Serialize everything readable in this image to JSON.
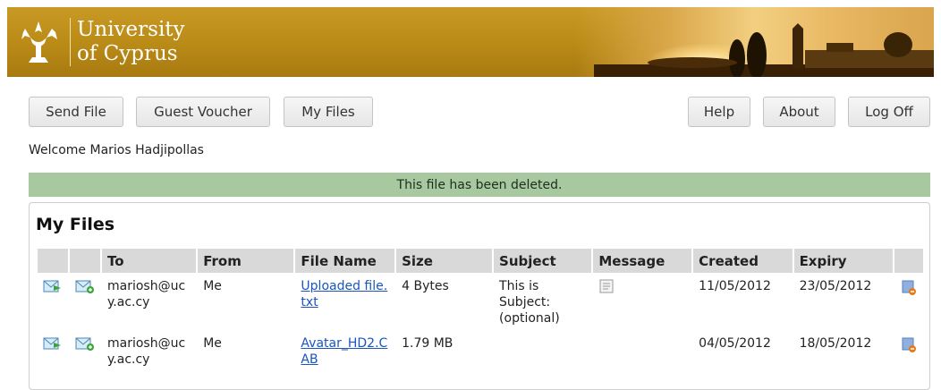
{
  "header": {
    "logo_line1": "University",
    "logo_line2": "of Cyprus"
  },
  "toolbar": {
    "send_file": "Send File",
    "guest_voucher": "Guest Voucher",
    "my_files": "My Files",
    "help": "Help",
    "about": "About",
    "log_off": "Log Off"
  },
  "welcome": "Welcome Marios Hadjipollas",
  "notice": "This file has been deleted.",
  "files": {
    "title": "My Files",
    "columns": [
      "To",
      "From",
      "File Name",
      "Size",
      "Subject",
      "Message",
      "Created",
      "Expiry"
    ],
    "rows": [
      {
        "to": "mariosh@ucy.ac.cy",
        "from": "Me",
        "file_name": "Uploaded file.txt",
        "size": "4 Bytes",
        "subject": "This is Subject: (optional)",
        "has_message": true,
        "created": "11/05/2012",
        "expiry": "23/05/2012"
      },
      {
        "to": "mariosh@ucy.ac.cy",
        "from": "Me",
        "file_name": "Avatar_HD2.CAB",
        "size": "1.79 MB",
        "subject": "",
        "has_message": false,
        "created": "04/05/2012",
        "expiry": "18/05/2012"
      }
    ]
  },
  "icons": {
    "resend": "envelope-arrow-icon",
    "add_recipient": "envelope-plus-icon",
    "message": "document-icon",
    "delete": "delete-file-icon"
  },
  "colors": {
    "banner": "#b98a16",
    "notice": "#a8c8a0",
    "link": "#1a55c0",
    "header_cell": "#d9d9d9"
  }
}
